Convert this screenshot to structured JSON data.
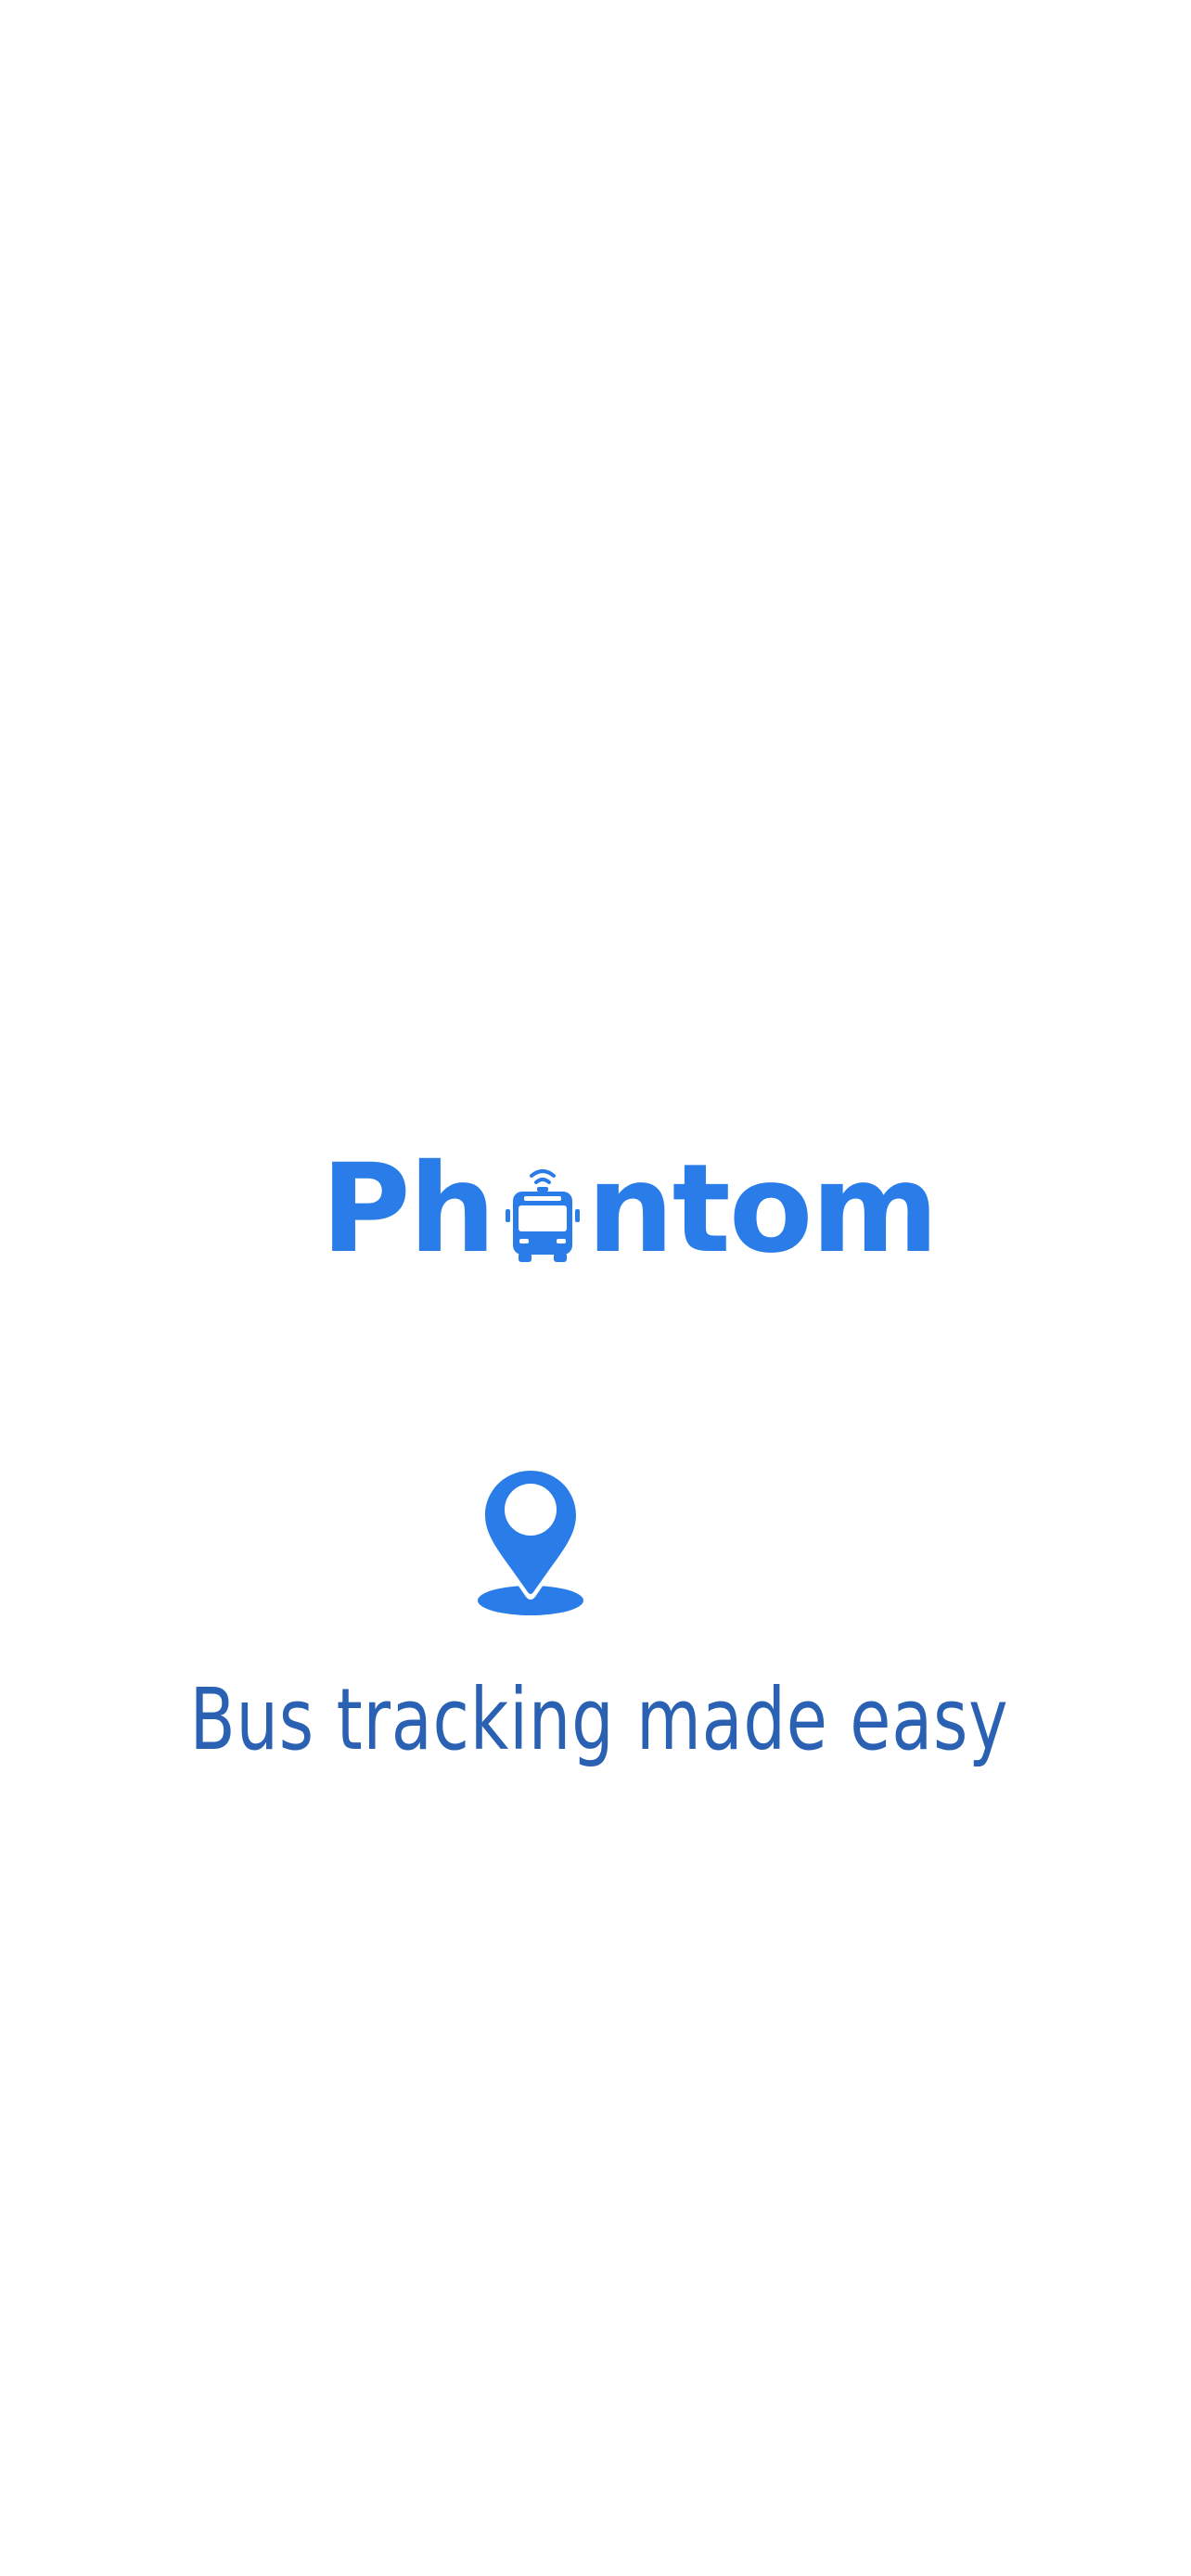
{
  "app": {
    "name_prefix": "Ph",
    "name_suffix": "ntom",
    "logo_icon": "bus-icon",
    "brand_color": "#2a7de8"
  },
  "splash": {
    "pin_icon": "location-pin-icon",
    "tagline": "Bus tracking made easy",
    "tagline_color": "#2b61b3",
    "background": "#ffffff"
  }
}
